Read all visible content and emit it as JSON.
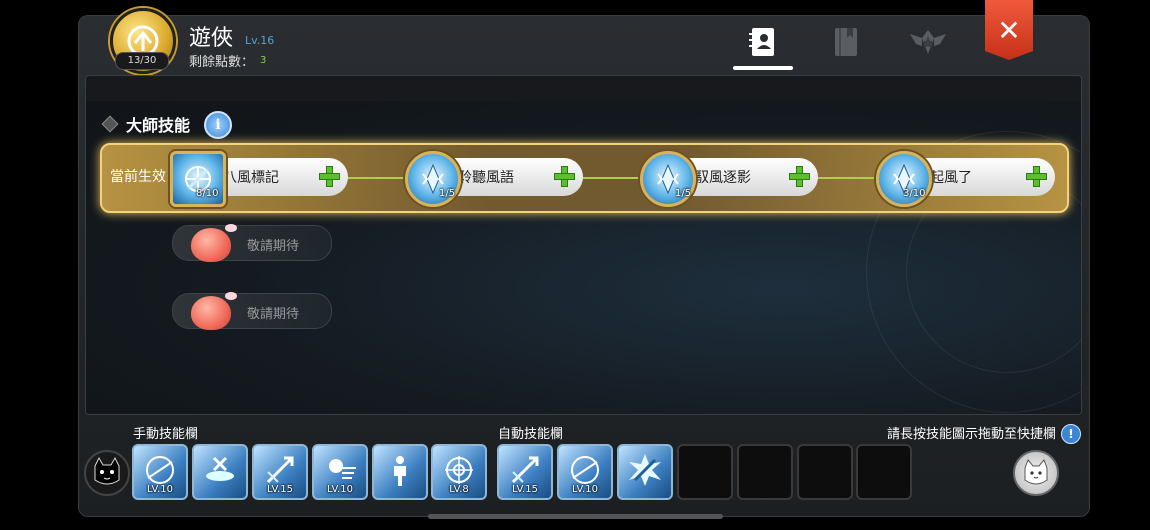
{
  "header": {
    "class_points": "13/30",
    "class_name": "遊俠",
    "class_level": "Lv.16",
    "remaining_points_label": "剩餘點數：",
    "remaining_points_value": "3",
    "tabs": [
      {
        "name": "tab-profile",
        "icon": "profile-card-icon",
        "active": true
      },
      {
        "name": "tab-book",
        "icon": "book-icon",
        "active": false
      },
      {
        "name": "tab-emblem",
        "icon": "winged-emblem-icon",
        "active": false
      }
    ],
    "close_label": "✕"
  },
  "section": {
    "title": "大師技能",
    "info_label": "i",
    "active_label": "當前生效"
  },
  "master_skills": [
    {
      "name": "八風標記",
      "level": "8/10",
      "icon": "wind-mark-icon"
    },
    {
      "name": "聆聽風語",
      "level": "1/5",
      "icon": "wind-crystal-icon"
    },
    {
      "name": "馭風逐影",
      "level": "1/5",
      "icon": "wind-crystal-icon"
    },
    {
      "name": "起風了",
      "level": "3/10",
      "icon": "wind-crystal-icon"
    }
  ],
  "locked_slots": [
    {
      "label": "敬請期待"
    },
    {
      "label": "敬請期待"
    }
  ],
  "skill_bar": {
    "manual_label": "手動技能欄",
    "auto_label": "自動技能欄",
    "hint": "請長按技能圖示拖動至快捷欄",
    "hint_icon_label": "!",
    "manual_slots": [
      {
        "icon": "arrow-storm-icon",
        "level": "LV.10"
      },
      {
        "icon": "trap-icon",
        "level": ""
      },
      {
        "icon": "arrow-strike-icon",
        "level": "LV.15"
      },
      {
        "icon": "falcon-icon",
        "level": "LV.10"
      },
      {
        "icon": "focus-body-icon",
        "level": ""
      },
      {
        "icon": "target-icon",
        "level": "LV.8"
      }
    ],
    "auto_slots": [
      {
        "icon": "arrow-strike-icon",
        "level": "LV.15"
      },
      {
        "icon": "arrow-storm-icon",
        "level": "LV.10"
      },
      {
        "icon": "sword-burst-icon",
        "level": ""
      },
      {
        "icon": "empty-slot",
        "level": ""
      },
      {
        "icon": "empty-slot",
        "level": ""
      },
      {
        "icon": "empty-slot",
        "level": ""
      },
      {
        "icon": "empty-slot",
        "level": ""
      }
    ]
  },
  "colors": {
    "accent_gold": "#f3d27a",
    "level_blue": "#4aa3e0",
    "points_green": "#7bd64a",
    "close_red": "#e04428",
    "plus_green": "#5bbf2e"
  }
}
